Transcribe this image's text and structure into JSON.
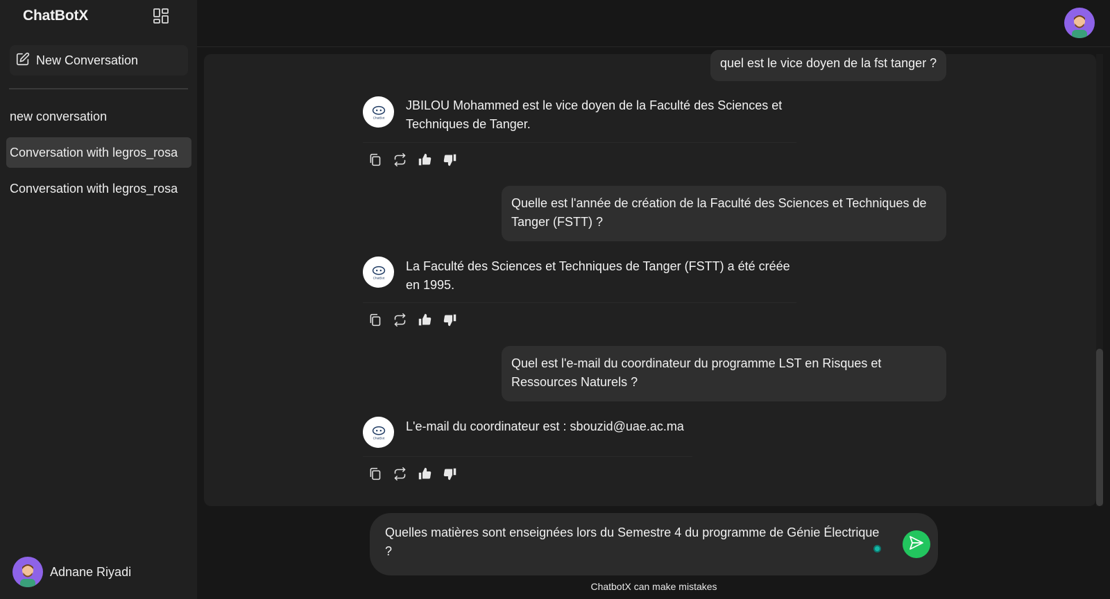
{
  "sidebar": {
    "brand": "ChatBotX",
    "new_conversation_label": "New Conversation",
    "conversations": [
      {
        "label": "new conversation",
        "active": false
      },
      {
        "label": "Conversation with legros_rosa",
        "active": true
      },
      {
        "label": "Conversation with legros_rosa",
        "active": false
      }
    ],
    "user_name": "Adnane Riyadi"
  },
  "messages": [
    {
      "role": "user",
      "text": "quel est le vice doyen de la fst tanger ?"
    },
    {
      "role": "bot",
      "lines": [
        "JBILOU Mohammed est le vice doyen de la Faculté des Sciences et",
        "Techniques de Tanger."
      ]
    },
    {
      "role": "user",
      "lines": [
        "Quelle est l'année de création de la Faculté des Sciences et Techniques de",
        "Tanger (FSTT) ?"
      ]
    },
    {
      "role": "bot",
      "lines": [
        "La Faculté des Sciences et Techniques de Tanger (FSTT) a été créée",
        "en 1995."
      ]
    },
    {
      "role": "user",
      "lines": [
        "Quel est l'e-mail du coordinateur du programme LST en Risques et",
        "Ressources Naturels ?"
      ]
    },
    {
      "role": "bot",
      "lines": [
        "L'e-mail du coordinateur est : sbouzid@uae.ac.ma"
      ]
    }
  ],
  "bot_avatar_label": "ChatBot",
  "input": {
    "lines": [
      "Quelles matières sont enseignées lors du Semestre 4 du programme de Génie Électrique",
      "?"
    ]
  },
  "disclaimer": "ChatbotX can make mistakes",
  "colors": {
    "accent_send": "#22c55e",
    "avatar_bg": "#8e63e8",
    "panel_bg": "#212121",
    "bubble_bg": "#2f2f2f"
  },
  "icons": [
    "layout-grid-icon",
    "edit-icon",
    "copy-icon",
    "regenerate-icon",
    "thumbs-up-icon",
    "thumbs-down-icon",
    "send-icon"
  ]
}
